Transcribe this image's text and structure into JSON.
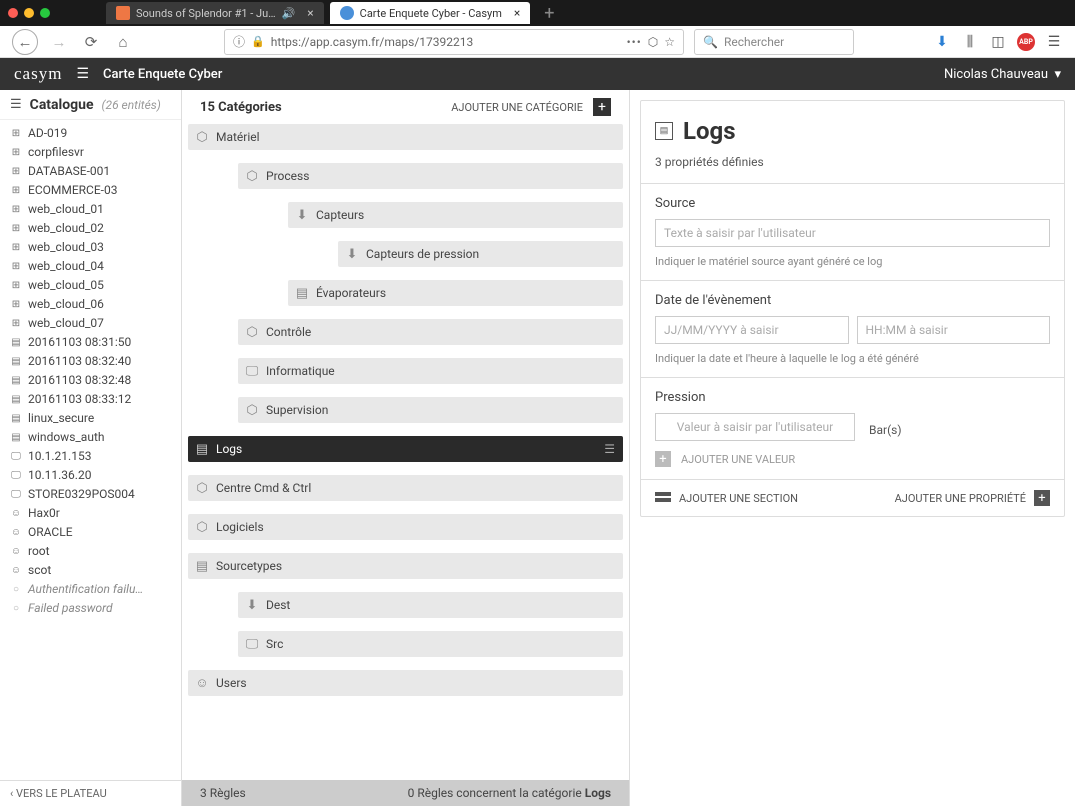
{
  "browser": {
    "tabs": [
      {
        "title": "Sounds of Splendor #1 - Ju…",
        "active": false,
        "audio": true
      },
      {
        "title": "Carte Enquete Cyber - Casym",
        "active": true
      }
    ],
    "url": "https://app.casym.fr/maps/17392213",
    "search_placeholder": "Rechercher"
  },
  "header": {
    "logo": "casym",
    "crumb": "Carte Enquete Cyber",
    "user": "Nicolas Chauveau"
  },
  "sidebar": {
    "title": "Catalogue",
    "count": "(26 entités)",
    "items": [
      {
        "icon": "plus",
        "label": "AD-019"
      },
      {
        "icon": "plus",
        "label": "corpfilesvr"
      },
      {
        "icon": "plus",
        "label": "DATABASE-001"
      },
      {
        "icon": "plus",
        "label": "ECOMMERCE-03"
      },
      {
        "icon": "plus",
        "label": "web_cloud_01"
      },
      {
        "icon": "plus",
        "label": "web_cloud_02"
      },
      {
        "icon": "plus",
        "label": "web_cloud_03"
      },
      {
        "icon": "plus",
        "label": "web_cloud_04"
      },
      {
        "icon": "plus",
        "label": "web_cloud_05"
      },
      {
        "icon": "plus",
        "label": "web_cloud_06"
      },
      {
        "icon": "plus",
        "label": "web_cloud_07"
      },
      {
        "icon": "file",
        "label": "20161103 08:31:50"
      },
      {
        "icon": "file",
        "label": "20161103 08:32:40"
      },
      {
        "icon": "file",
        "label": "20161103 08:32:48"
      },
      {
        "icon": "file",
        "label": "20161103 08:33:12"
      },
      {
        "icon": "file",
        "label": "linux_secure"
      },
      {
        "icon": "file",
        "label": "windows_auth"
      },
      {
        "icon": "monitor",
        "label": "10.1.21.153"
      },
      {
        "icon": "monitor",
        "label": "10.11.36.20"
      },
      {
        "icon": "monitor",
        "label": "STORE0329POS004"
      },
      {
        "icon": "user",
        "label": "Hax0r"
      },
      {
        "icon": "user",
        "label": "ORACLE"
      },
      {
        "icon": "user",
        "label": "root"
      },
      {
        "icon": "user",
        "label": "scot"
      },
      {
        "icon": "event",
        "label": "Authentification failu…",
        "event": true
      },
      {
        "icon": "event",
        "label": "Failed password",
        "event": true
      }
    ],
    "footer": "‹ VERS LE PLATEAU"
  },
  "middle": {
    "header_title": "15 Catégories",
    "add_label": "AJOUTER UNE CATÉGORIE",
    "categories": [
      {
        "level": 0,
        "icon": "cube",
        "label": "Matériel"
      },
      {
        "level": 1,
        "icon": "cube",
        "label": "Process"
      },
      {
        "level": 2,
        "icon": "in",
        "label": "Capteurs"
      },
      {
        "level": 3,
        "icon": "in",
        "label": "Capteurs de pression"
      },
      {
        "level": 2,
        "icon": "file",
        "label": "Évaporateurs"
      },
      {
        "level": 1,
        "icon": "cube",
        "label": "Contrôle"
      },
      {
        "level": 1,
        "icon": "monitor",
        "label": "Informatique"
      },
      {
        "level": 1,
        "icon": "cube",
        "label": "Supervision"
      },
      {
        "level": 0,
        "icon": "file",
        "label": "Logs",
        "selected": true
      },
      {
        "level": 0,
        "icon": "cube",
        "label": "Centre Cmd & Ctrl"
      },
      {
        "level": 0,
        "icon": "cube",
        "label": "Logiciels"
      },
      {
        "level": 0,
        "icon": "file",
        "label": "Sourcetypes"
      },
      {
        "level": 1,
        "icon": "in",
        "label": "Dest"
      },
      {
        "level": 1,
        "icon": "monitor",
        "label": "Src"
      },
      {
        "level": 0,
        "icon": "user",
        "label": "Users"
      }
    ],
    "footer_left": "3 Règles",
    "footer_right_pre": "0 Règles concernent la catégorie ",
    "footer_right_bold": "Logs"
  },
  "right": {
    "title": "Logs",
    "subtitle": "3 propriétés définies",
    "sections": [
      {
        "label": "Source",
        "placeholder": "Texte à saisir par l'utilisateur",
        "hint": "Indiquer le matériel source ayant généré ce log"
      },
      {
        "label": "Date de l'évènement",
        "placeholders": [
          "JJ/MM/YYYY à saisir",
          "HH:MM à saisir"
        ],
        "hint": "Indiquer la date et l'heure à laquelle le log a été généré"
      },
      {
        "label": "Pression",
        "placeholder": "Valeur à saisir par l'utilisateur",
        "unit": "Bar(s)",
        "add_value": "AJOUTER UNE VALEUR"
      }
    ],
    "footer_section": "AJOUTER UNE SECTION",
    "footer_prop": "AJOUTER UNE PROPRIÉTÉ"
  }
}
